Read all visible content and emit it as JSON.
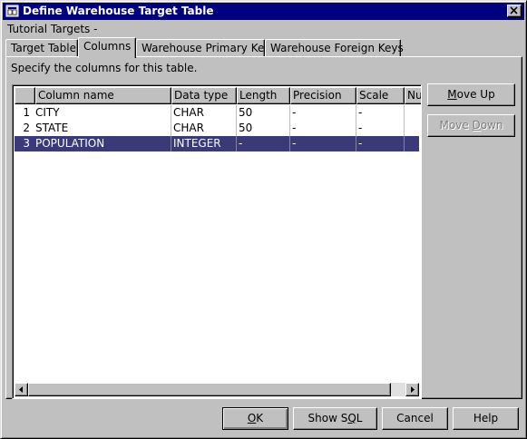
{
  "window": {
    "title": "Define Warehouse Target Table",
    "subtitle": "Tutorial Targets -"
  },
  "tabs": [
    {
      "label": "Target Table",
      "active": false
    },
    {
      "label": "Columns",
      "active": true
    },
    {
      "label": "Warehouse Primary Key",
      "active": false
    },
    {
      "label": "Warehouse Foreign Keys",
      "active": false
    }
  ],
  "columns_tab": {
    "instruction": "Specify the columns for this table."
  },
  "grid": {
    "headers": [
      "",
      "Column name",
      "Data type",
      "Length",
      "Precision",
      "Scale",
      "Nu"
    ],
    "rows": [
      {
        "num": "1",
        "name": "CITY",
        "type": "CHAR",
        "length": "50",
        "precision": "-",
        "scale": "-",
        "nullable": "",
        "selected": false
      },
      {
        "num": "2",
        "name": "STATE",
        "type": "CHAR",
        "length": "50",
        "precision": "-",
        "scale": "-",
        "nullable": "",
        "selected": false
      },
      {
        "num": "3",
        "name": "POPULATION",
        "type": "INTEGER",
        "length": "-",
        "precision": "-",
        "scale": "-",
        "nullable": "",
        "selected": true
      }
    ]
  },
  "side_buttons": {
    "move_up": {
      "pre": "",
      "ul": "M",
      "post": "ove Up",
      "enabled": true
    },
    "move_down": {
      "pre": "Move ",
      "ul": "D",
      "post": "own",
      "enabled": false
    }
  },
  "footer_buttons": {
    "ok": {
      "pre": "",
      "ul": "O",
      "post": "K"
    },
    "show_sql": {
      "pre": "Show S",
      "ul": "Q",
      "post": "L"
    },
    "cancel": {
      "label": "Cancel"
    },
    "help": {
      "label": "Help"
    }
  },
  "colors": {
    "titlebar": "#000080",
    "selection": "#3a3a78",
    "face": "#c0c0c0"
  },
  "icons": [
    "app-icon",
    "close-icon",
    "scroll-left-icon",
    "scroll-right-icon"
  ]
}
